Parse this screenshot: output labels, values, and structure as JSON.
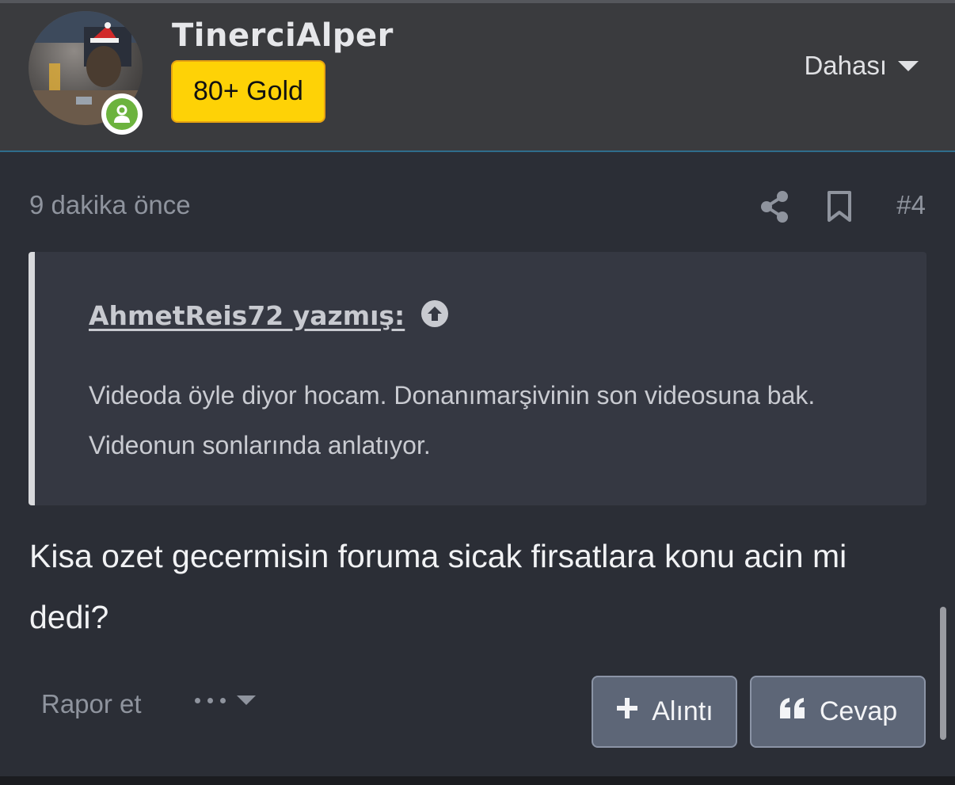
{
  "user": {
    "name": "TinerciAlper",
    "badge": "80+ Gold",
    "badge_color": "#fed206",
    "status": "online",
    "status_color": "#6cb33e"
  },
  "header": {
    "more_label": "Dahası"
  },
  "post": {
    "timestamp": "9 dakika önce",
    "number": "#4",
    "quote": {
      "author_label": "AhmetReis72 yazmış:",
      "text": "Videoda öyle diyor hocam. Donanımarşivinin son videosuna bak. Videonun sonlarında anlatıyor."
    },
    "body": "Kisa ozet gecermisin foruma sicak firsatlara konu acin mi dedi?"
  },
  "actions": {
    "report_label": "Rapor et",
    "quote_label": "Alıntı",
    "reply_label": "Cevap"
  },
  "icons": {
    "share": "share-icon",
    "bookmark": "bookmark-icon",
    "jump": "arrow-up-circle-icon",
    "plus": "plus-icon",
    "quote": "quote-marks-icon"
  }
}
